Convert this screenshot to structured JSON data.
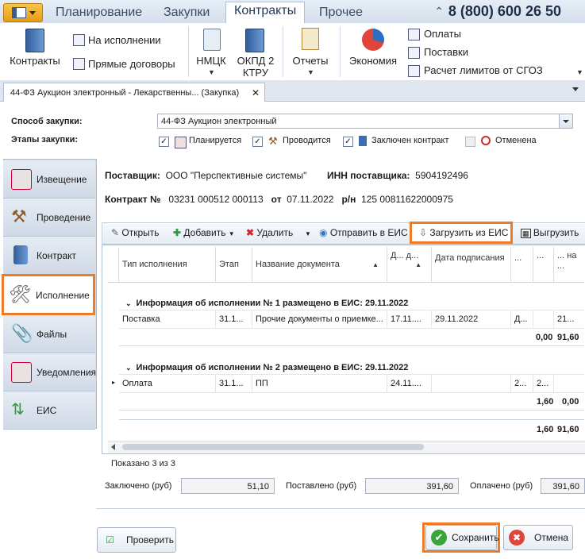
{
  "ribbon_tabs": [
    "Планирование",
    "Закупки",
    "Контракты",
    "Прочее"
  ],
  "active_tab": "Контракты",
  "phone": "8 (800) 600 26 50",
  "ribbon": {
    "contracts": "Контракты",
    "in_execution": "На исполнении",
    "direct_contracts": "Прямые договоры",
    "nmck": "НМЦК",
    "okpd": "ОКПД 2 КТРУ",
    "reports": "Отчеты",
    "economy": "Экономия",
    "payments": "Оплаты",
    "deliveries": "Поставки",
    "limits": "Расчет лимитов от СГОЗ"
  },
  "doc_tab": "44-ФЗ Аукцион электронный - Лекарственны... (Закупка)",
  "form": {
    "method_label": "Способ закупки:",
    "method_value": "44-ФЗ Аукцион электронный",
    "stages_label": "Этапы закупки:",
    "stages": [
      {
        "label": "Планируется",
        "checked": "✓"
      },
      {
        "label": "Проводится",
        "checked": "✓"
      },
      {
        "label": "Заключен контракт",
        "checked": "✓"
      },
      {
        "label": "Отменена",
        "checked": ""
      }
    ]
  },
  "nav": [
    "Извещение",
    "Проведение",
    "Контракт",
    "Исполнение",
    "Файлы",
    "Уведомления",
    "ЕИС"
  ],
  "nav_selected": "Исполнение",
  "header": {
    "supplier_label": "Поставщик:",
    "supplier": "ООО \"Перспективные системы\"",
    "inn_label": "ИНН поставщика:",
    "inn": "5904192496",
    "contract_label": "Контракт №",
    "contract_no": "03231  000512  000113",
    "from_label": "от",
    "date": "07.11.2022",
    "rs_label": "р/н",
    "rs": "125    00811622000975"
  },
  "toolbar": {
    "open": "Открыть",
    "add": "Добавить",
    "delete": "Удалить",
    "send": "Отправить в ЕИС",
    "load": "Загрузить из ЕИС",
    "export": "Выгрузить"
  },
  "grid": {
    "columns": [
      "Тип исполнения",
      "Этап",
      "Название документа",
      "Д... д...",
      "Дата подписания",
      "...",
      "...",
      "... на ..."
    ],
    "group1": "Информация об исполнении № 1   размещено в ЕИС: 29.11.2022",
    "row1": [
      "Поставка",
      "31.1...",
      "Прочие документы о приемке...",
      "17.11....",
      "29.11.2022",
      "Д...",
      "",
      "21..."
    ],
    "sum1": [
      "0,00",
      "91,60"
    ],
    "group2": "Информация об исполнении № 2   размещено в ЕИС: 29.11.2022",
    "row2": [
      "Оплата",
      "31.1...",
      "ПП",
      "24.11....",
      "",
      "2...",
      "2...",
      ""
    ],
    "sum2": [
      "1,60",
      "0,00"
    ],
    "total": [
      "1,60",
      "91,60"
    ]
  },
  "shown": "Показано 3 из 3",
  "totals": {
    "concluded_label": "Заключено (руб)",
    "concluded": "51,10",
    "delivered_label": "Поставлено (руб)",
    "delivered": "391,60",
    "paid_label": "Оплачено (руб)",
    "paid": "391,60"
  },
  "buttons": {
    "check": "Проверить",
    "save": "Сохранить",
    "cancel": "Отмена"
  }
}
